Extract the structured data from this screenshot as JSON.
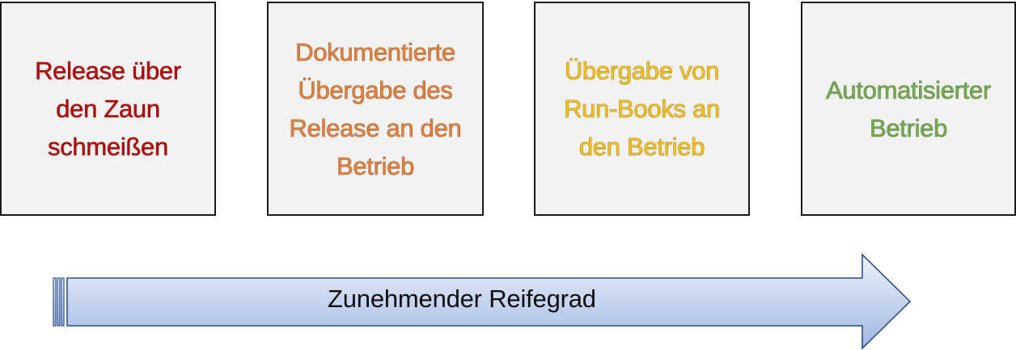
{
  "stages": [
    {
      "text": "Release über\nden Zaun\nschmeißen",
      "color": "#c00000"
    },
    {
      "text": "Dokumentierte\nÜbergabe des\nRelease an den\nBetrieb",
      "color": "#ed7d31"
    },
    {
      "text": "Übergabe von\nRun-Books an\nden Betrieb",
      "color": "#ffc000"
    },
    {
      "text": "Automatisierter\nBetrieb",
      "color": "#70ad47"
    }
  ],
  "arrow": {
    "label": "Zunehmender Reifegrad",
    "fill_light": "#e9eef8",
    "fill_dark": "#9fb7e0",
    "stroke": "#2f4f8f"
  }
}
